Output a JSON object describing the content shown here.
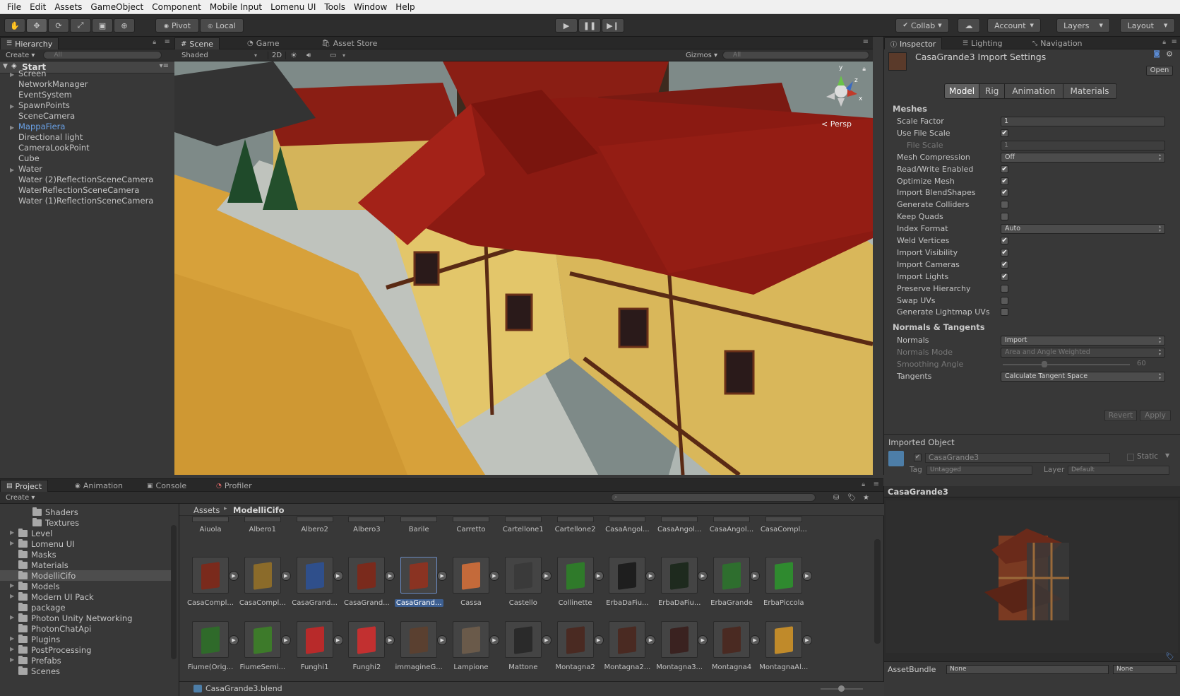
{
  "menu": [
    "File",
    "Edit",
    "Assets",
    "GameObject",
    "Component",
    "Mobile Input",
    "Lomenu UI",
    "Tools",
    "Window",
    "Help"
  ],
  "toolbar": {
    "pivot": "Pivot",
    "local": "Local",
    "collab": "Collab",
    "account": "Account",
    "layers": "Layers",
    "layout": "Layout"
  },
  "hierarchy": {
    "tab": "Hierarchy",
    "create": "Create",
    "search_placeholder": "All",
    "scene": "Start",
    "items": [
      {
        "label": "Screen",
        "expandable": true
      },
      {
        "label": "NetworkManager",
        "expandable": false
      },
      {
        "label": "EventSystem",
        "expandable": false
      },
      {
        "label": "SpawnPoints",
        "expandable": true
      },
      {
        "label": "SceneCamera",
        "expandable": false
      },
      {
        "label": "MappaFiera",
        "expandable": true,
        "prefab": true
      },
      {
        "label": "Directional light",
        "expandable": false
      },
      {
        "label": "CameraLookPoint",
        "expandable": false
      },
      {
        "label": "Cube",
        "expandable": false
      },
      {
        "label": "Water",
        "expandable": true
      },
      {
        "label": "Water (2)ReflectionSceneCamera",
        "expandable": false
      },
      {
        "label": "WaterReflectionSceneCamera",
        "expandable": false
      },
      {
        "label": "Water (1)ReflectionSceneCamera",
        "expandable": false
      }
    ]
  },
  "scene": {
    "tabs": [
      "Scene",
      "Game",
      "Asset Store"
    ],
    "shading": "Shaded",
    "mode2d": "2D",
    "gizmos": "Gizmos",
    "search_placeholder": "All",
    "persp": "Persp",
    "axis_y": "y",
    "axis_z": "z",
    "axis_x": "x"
  },
  "inspector": {
    "tabs": [
      "Inspector",
      "Lighting",
      "Navigation"
    ],
    "title": "CasaGrande3 Import Settings",
    "open": "Open",
    "subtabs": [
      "Model",
      "Rig",
      "Animation",
      "Materials"
    ],
    "meshes_header": "Meshes",
    "meshes": [
      {
        "label": "Scale Factor",
        "type": "field",
        "value": "1"
      },
      {
        "label": "Use File Scale",
        "type": "check",
        "checked": true
      },
      {
        "label": "File Scale",
        "type": "field",
        "value": "1",
        "disabled": true,
        "indent": true
      },
      {
        "label": "Mesh Compression",
        "type": "dropdown",
        "value": "Off"
      },
      {
        "label": "Read/Write Enabled",
        "type": "check",
        "checked": true
      },
      {
        "label": "Optimize Mesh",
        "type": "check",
        "checked": true
      },
      {
        "label": "Import BlendShapes",
        "type": "check",
        "checked": true
      },
      {
        "label": "Generate Colliders",
        "type": "check",
        "checked": false
      },
      {
        "label": "Keep Quads",
        "type": "check",
        "checked": false
      },
      {
        "label": "Index Format",
        "type": "dropdown",
        "value": "Auto"
      },
      {
        "label": "Weld Vertices",
        "type": "check",
        "checked": true
      },
      {
        "label": "Import Visibility",
        "type": "check",
        "checked": true
      },
      {
        "label": "Import Cameras",
        "type": "check",
        "checked": true
      },
      {
        "label": "Import Lights",
        "type": "check",
        "checked": true
      },
      {
        "label": "Preserve Hierarchy",
        "type": "check",
        "checked": false
      },
      {
        "label": "Swap UVs",
        "type": "check",
        "checked": false
      },
      {
        "label": "Generate Lightmap UVs",
        "type": "check",
        "checked": false
      }
    ],
    "normals_header": "Normals & Tangents",
    "normals": [
      {
        "label": "Normals",
        "type": "dropdown",
        "value": "Import"
      },
      {
        "label": "Normals Mode",
        "type": "dropdown",
        "value": "Area and Angle Weighted",
        "disabled": true
      },
      {
        "label": "Smoothing Angle",
        "type": "slider",
        "value": "60",
        "fraction": 0.33,
        "disabled": true
      },
      {
        "label": "Tangents",
        "type": "dropdown",
        "value": "Calculate Tangent Space"
      }
    ],
    "revert": "Revert",
    "apply": "Apply",
    "imported_header": "Imported Object",
    "object_name": "CasaGrande3",
    "static": "Static",
    "tag_label": "Tag",
    "tag_value": "Untagged",
    "layer_label": "Layer",
    "layer_value": "Default",
    "preview_title": "CasaGrande3",
    "assetbundle_label": "AssetBundle",
    "assetbundle_value": "None",
    "assetbundle_variant": "None"
  },
  "project": {
    "tabs": [
      "Project",
      "Animation",
      "Console",
      "Profiler"
    ],
    "create": "Create",
    "breadcrumb_root": "Assets",
    "breadcrumb_current": "ModelliCifo",
    "folders": [
      {
        "label": "Shaders",
        "indent": 2,
        "expandable": false
      },
      {
        "label": "Textures",
        "indent": 2,
        "expandable": false
      },
      {
        "label": "Level",
        "indent": 1,
        "expandable": true
      },
      {
        "label": "Lomenu UI",
        "indent": 1,
        "expandable": true
      },
      {
        "label": "Masks",
        "indent": 1,
        "expandable": false
      },
      {
        "label": "Materials",
        "indent": 1,
        "expandable": false
      },
      {
        "label": "ModelliCifo",
        "indent": 1,
        "expandable": false,
        "selected": true
      },
      {
        "label": "Models",
        "indent": 1,
        "expandable": true
      },
      {
        "label": "Modern UI Pack",
        "indent": 1,
        "expandable": true
      },
      {
        "label": "package",
        "indent": 1,
        "expandable": false
      },
      {
        "label": "Photon Unity Networking",
        "indent": 1,
        "expandable": true
      },
      {
        "label": "PhotonChatApi",
        "indent": 1,
        "expandable": false
      },
      {
        "label": "Plugins",
        "indent": 1,
        "expandable": true
      },
      {
        "label": "PostProcessing",
        "indent": 1,
        "expandable": true
      },
      {
        "label": "Prefabs",
        "indent": 1,
        "expandable": true
      },
      {
        "label": "Scenes",
        "indent": 1,
        "expandable": false
      }
    ],
    "top_row": [
      "Aiuola",
      "Albero1",
      "Albero2",
      "Albero3",
      "Barile",
      "Carretto",
      "Cartellone1",
      "Cartellone2",
      "CasaAngol...",
      "CasaAngol...",
      "CasaAngol...",
      "CasaCompl..."
    ],
    "row1": [
      {
        "label": "CasaCompl...",
        "color": "#7a2a1c"
      },
      {
        "label": "CasaCompl...",
        "color": "#8b6b2a"
      },
      {
        "label": "CasaGrand...",
        "color": "#2f4f8b"
      },
      {
        "label": "CasaGrand...",
        "color": "#7a2a1c"
      },
      {
        "label": "CasaGrand...",
        "color": "#8a3322",
        "selected": true
      },
      {
        "label": "Cassa",
        "color": "#c46a3a"
      },
      {
        "label": "Castello",
        "color": "#3a3a3a"
      },
      {
        "label": "Collinette",
        "color": "#2f7a2a"
      },
      {
        "label": "ErbaDaFiu...",
        "color": "#1e1e1e"
      },
      {
        "label": "ErbaDaFiu...",
        "color": "#1e2a1e"
      },
      {
        "label": "ErbaGrande",
        "color": "#2e6e2e"
      },
      {
        "label": "ErbaPiccola",
        "color": "#2f8a2f"
      }
    ],
    "row2": [
      {
        "label": "Fiume(Orig...",
        "color": "#2f6a2a"
      },
      {
        "label": "FiumeSemi...",
        "color": "#3d7a2a"
      },
      {
        "label": "Funghi1",
        "color": "#b82a2a"
      },
      {
        "label": "Funghi2",
        "color": "#c23030"
      },
      {
        "label": "immagineG...",
        "color": "#5a4030"
      },
      {
        "label": "Lampione",
        "color": "#6a5a4a"
      },
      {
        "label": "Mattone",
        "color": "#2a2a2a"
      },
      {
        "label": "Montagna2",
        "color": "#4a2a22"
      },
      {
        "label": "Montagna2...",
        "color": "#4a2a22"
      },
      {
        "label": "Montagna3...",
        "color": "#3a2220"
      },
      {
        "label": "Montagna4",
        "color": "#4a2a22"
      },
      {
        "label": "MontagnaAl...",
        "color": "#c08a2a"
      }
    ],
    "selected_file": "CasaGrande3.blend"
  }
}
